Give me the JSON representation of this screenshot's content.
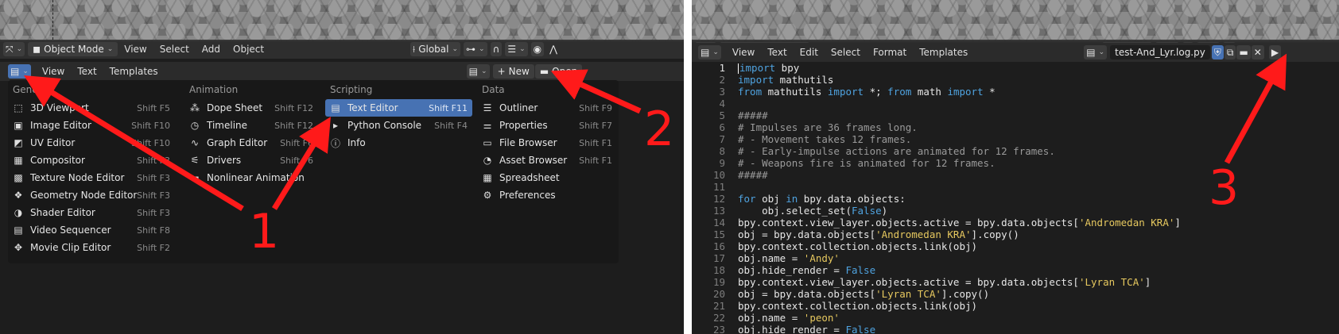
{
  "viewport_header": {
    "mode": "Object Mode",
    "menus": [
      "View",
      "Select",
      "Add",
      "Object"
    ],
    "orientation": "Global"
  },
  "left_text_header": {
    "menus": [
      "View",
      "Text",
      "Templates"
    ],
    "new_label": "New",
    "open_label": "Open"
  },
  "editor_menu": {
    "columns": [
      {
        "title": "General",
        "items": [
          {
            "icon": "viewport-icon",
            "glyph": "⬚",
            "label": "3D Viewport",
            "shortcut": "Shift F5"
          },
          {
            "icon": "image-icon",
            "glyph": "▣",
            "label": "Image Editor",
            "shortcut": "Shift F10"
          },
          {
            "icon": "uv-icon",
            "glyph": "◩",
            "label": "UV Editor",
            "shortcut": "Shift F10"
          },
          {
            "icon": "compositor-icon",
            "glyph": "▦",
            "label": "Compositor",
            "shortcut": "Shift F3"
          },
          {
            "icon": "texture-node-icon",
            "glyph": "▩",
            "label": "Texture Node Editor",
            "shortcut": "Shift F3"
          },
          {
            "icon": "geometry-node-icon",
            "glyph": "❖",
            "label": "Geometry Node Editor",
            "shortcut": "Shift F3"
          },
          {
            "icon": "shader-icon",
            "glyph": "◑",
            "label": "Shader Editor",
            "shortcut": "Shift F3"
          },
          {
            "icon": "video-sequencer-icon",
            "glyph": "▤",
            "label": "Video Sequencer",
            "shortcut": "Shift F8"
          },
          {
            "icon": "movie-clip-icon",
            "glyph": "✥",
            "label": "Movie Clip Editor",
            "shortcut": "Shift F2"
          }
        ]
      },
      {
        "title": "Animation",
        "items": [
          {
            "icon": "dope-sheet-icon",
            "glyph": "⁂",
            "label": "Dope Sheet",
            "shortcut": "Shift F12"
          },
          {
            "icon": "timeline-icon",
            "glyph": "◷",
            "label": "Timeline",
            "shortcut": "Shift F12"
          },
          {
            "icon": "graph-editor-icon",
            "glyph": "∿",
            "label": "Graph Editor",
            "shortcut": "Shift F6"
          },
          {
            "icon": "drivers-icon",
            "glyph": "⚟",
            "label": "Drivers",
            "shortcut": "Shift F6"
          },
          {
            "icon": "nla-icon",
            "glyph": "▬",
            "label": "Nonlinear Animation",
            "shortcut": ""
          }
        ]
      },
      {
        "title": "Scripting",
        "items": [
          {
            "icon": "text-editor-icon",
            "glyph": "▤",
            "label": "Text Editor",
            "shortcut": "Shift F11",
            "selected": true
          },
          {
            "icon": "python-console-icon",
            "glyph": "▸",
            "label": "Python Console",
            "shortcut": "Shift F4"
          },
          {
            "icon": "info-icon",
            "glyph": "ⓘ",
            "label": "Info",
            "shortcut": ""
          }
        ]
      },
      {
        "title": "Data",
        "items": [
          {
            "icon": "outliner-icon",
            "glyph": "☰",
            "label": "Outliner",
            "shortcut": "Shift F9"
          },
          {
            "icon": "properties-icon",
            "glyph": "⚌",
            "label": "Properties",
            "shortcut": "Shift F7"
          },
          {
            "icon": "file-browser-icon",
            "glyph": "▭",
            "label": "File Browser",
            "shortcut": "Shift F1"
          },
          {
            "icon": "asset-browser-icon",
            "glyph": "◔",
            "label": "Asset Browser",
            "shortcut": "Shift F1"
          },
          {
            "icon": "spreadsheet-icon",
            "glyph": "▦",
            "label": "Spreadsheet",
            "shortcut": ""
          },
          {
            "icon": "preferences-icon",
            "glyph": "⚙",
            "label": "Preferences",
            "shortcut": ""
          }
        ]
      }
    ]
  },
  "right_text_header": {
    "menus": [
      "View",
      "Text",
      "Edit",
      "Select",
      "Format",
      "Templates"
    ],
    "filename": "test-And_Lyr.log.py"
  },
  "code_lines": [
    [
      [
        "kw",
        "import"
      ],
      [
        "src",
        " bpy"
      ]
    ],
    [
      [
        "kw",
        "import"
      ],
      [
        "src",
        " mathutils"
      ]
    ],
    [
      [
        "kw",
        "from"
      ],
      [
        "src",
        " mathutils "
      ],
      [
        "kw",
        "import"
      ],
      [
        "src",
        " *; "
      ],
      [
        "kw",
        "from"
      ],
      [
        "src",
        " math "
      ],
      [
        "kw",
        "import"
      ],
      [
        "src",
        " *"
      ]
    ],
    [],
    [
      [
        "cm",
        "#####"
      ]
    ],
    [
      [
        "cm",
        "# Impulses are 36 frames long."
      ]
    ],
    [
      [
        "cm",
        "# - Movement takes 12 frames."
      ]
    ],
    [
      [
        "cm",
        "# - Early-impulse actions are animated for 12 frames."
      ]
    ],
    [
      [
        "cm",
        "# - Weapons fire is animated for 12 frames."
      ]
    ],
    [
      [
        "cm",
        "#####"
      ]
    ],
    [],
    [
      [
        "kw",
        "for"
      ],
      [
        "src",
        " obj "
      ],
      [
        "kw",
        "in"
      ],
      [
        "src",
        " bpy.data.objects:"
      ]
    ],
    [
      [
        "src",
        "    obj.select_set("
      ],
      [
        "bl",
        "False"
      ],
      [
        "src",
        ")"
      ]
    ],
    [
      [
        "src",
        "bpy.context.view_layer.objects.active = bpy.data.objects["
      ],
      [
        "st",
        "'Andromedan KRA'"
      ],
      [
        "src",
        "]"
      ]
    ],
    [
      [
        "src",
        "obj = bpy.data.objects["
      ],
      [
        "st",
        "'Andromedan KRA'"
      ],
      [
        "src",
        "].copy()"
      ]
    ],
    [
      [
        "src",
        "bpy.context.collection.objects.link(obj)"
      ]
    ],
    [
      [
        "src",
        "obj.name = "
      ],
      [
        "st",
        "'Andy'"
      ]
    ],
    [
      [
        "src",
        "obj.hide_render = "
      ],
      [
        "bl",
        "False"
      ]
    ],
    [
      [
        "src",
        "bpy.context.view_layer.objects.active = bpy.data.objects["
      ],
      [
        "st",
        "'Lyran TCA'"
      ],
      [
        "src",
        "]"
      ]
    ],
    [
      [
        "src",
        "obj = bpy.data.objects["
      ],
      [
        "st",
        "'Lyran TCA'"
      ],
      [
        "src",
        "].copy()"
      ]
    ],
    [
      [
        "src",
        "bpy.context.collection.objects.link(obj)"
      ]
    ],
    [
      [
        "src",
        "obj.name = "
      ],
      [
        "st",
        "'peon'"
      ]
    ],
    [
      [
        "src",
        "obj.hide_render = "
      ],
      [
        "bl",
        "False"
      ]
    ]
  ],
  "annotations": {
    "labels": [
      "1",
      "2",
      "3"
    ],
    "color": "#ff1a1a"
  },
  "colors": {
    "accent": "#4772b3",
    "background": "#1d1d1d"
  }
}
